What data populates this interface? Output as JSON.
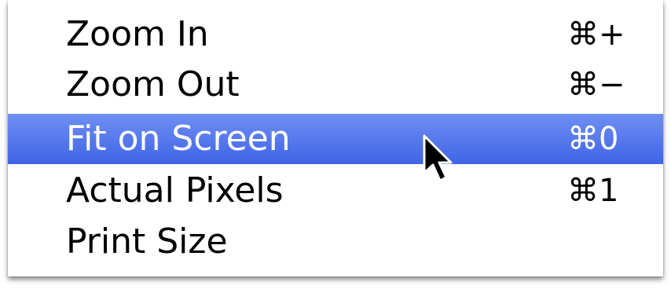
{
  "menu": {
    "items": [
      {
        "label": "Zoom In",
        "shortcut": "⌘+",
        "highlighted": false
      },
      {
        "label": "Zoom Out",
        "shortcut": "⌘−",
        "highlighted": false
      },
      {
        "label": "Fit on Screen",
        "shortcut": "⌘0",
        "highlighted": true
      },
      {
        "label": "Actual Pixels",
        "shortcut": "⌘1",
        "highlighted": false
      },
      {
        "label": "Print Size",
        "shortcut": "",
        "highlighted": false
      }
    ]
  },
  "colors": {
    "highlight": "#4f73ea",
    "text": "#000000",
    "highlight_text": "#ffffff"
  },
  "cursor": {
    "icon": "arrow-pointer-icon"
  }
}
